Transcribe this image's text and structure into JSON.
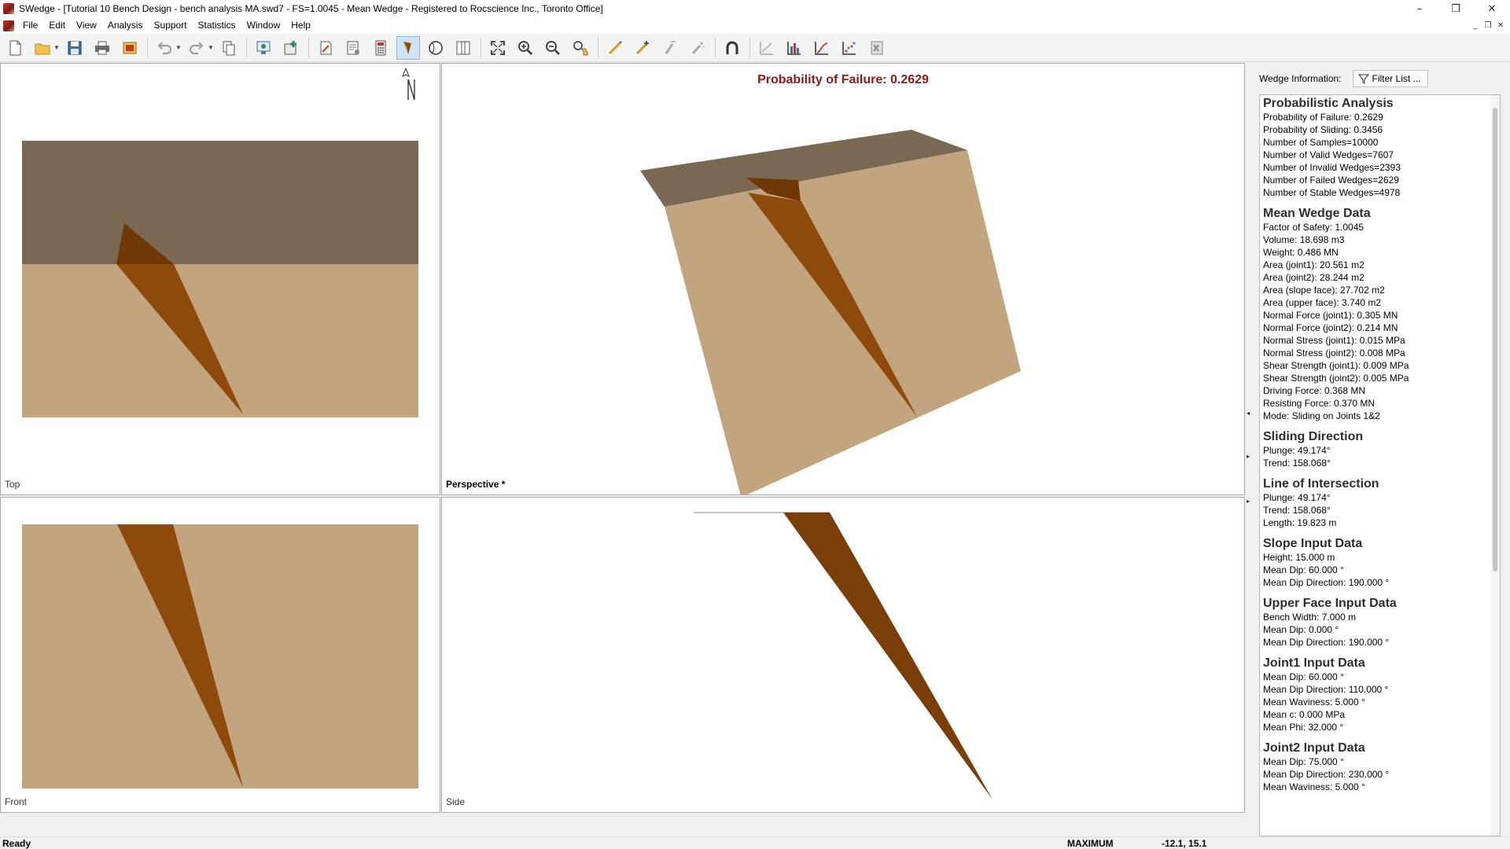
{
  "window": {
    "title": "SWedge - [Tutorial 10 Bench Design - bench analysis MA.swd7 - FS=1.0045 - Mean Wedge - Registered to Rocscience Inc., Toronto Office]",
    "controls": {
      "minimize": "–",
      "maximize": "❐",
      "close": "✕"
    }
  },
  "menu": {
    "items": [
      "File",
      "Edit",
      "View",
      "Analysis",
      "Support",
      "Statistics",
      "Window",
      "Help"
    ],
    "mdi": {
      "minimize": "_",
      "restore": "❐",
      "close": "✕"
    }
  },
  "toolbar": {
    "icons": [
      "new-file-icon",
      "open-folder-icon",
      "save-icon",
      "print-icon",
      "export-image-icon",
      "undo-icon",
      "redo-icon",
      "copy-icon",
      "input-data-icon",
      "add-joint-icon",
      "field-data-icon",
      "analysis-settings-icon",
      "compute-icon",
      "wedge-view-icon",
      "stereonet-icon",
      "split-view-icon",
      "zoom-all-icon",
      "zoom-in-icon",
      "zoom-out-icon",
      "pan-icon",
      "measure-icon",
      "add-pin-icon",
      "remove-pin-icon",
      "wand-icon",
      "magnet-icon",
      "line-chart-disabled-icon",
      "histogram-icon",
      "cumulative-icon",
      "scatter-icon",
      "excel-icon"
    ]
  },
  "views": {
    "top": {
      "label": "Top"
    },
    "perspective": {
      "label": "Perspective *",
      "heading": "Probability of Failure: 0.2629"
    },
    "front": {
      "label": "Front"
    },
    "side": {
      "label": "Side"
    }
  },
  "colors": {
    "upper_face": "#7b6852",
    "slope_face": "#c2a47f",
    "wedge": "#8e4a0a",
    "wedge_dark": "#6f3907",
    "side_wedge": "#7a3e08",
    "heading": "#8b1a1a"
  },
  "panel": {
    "header_label": "Wedge Information:",
    "filter_label": "Filter List ...",
    "sections": [
      {
        "title": "Probabilistic Analysis",
        "lines": [
          "Probability of Failure: 0.2629",
          "Probability of Sliding: 0.3456",
          "Number of Samples=10000",
          "Number of Valid Wedges=7607",
          "Number of Invalid Wedges=2393",
          "Number of Failed Wedges=2629",
          "Number of Stable Wedges=4978"
        ]
      },
      {
        "title": "Mean Wedge Data",
        "lines": [
          "Factor of Safety: 1.0045",
          "Volume: 18.698 m3",
          "Weight: 0.486 MN",
          "Area (joint1): 20.561 m2",
          "Area (joint2): 28.244 m2",
          "Area (slope face): 27.702 m2",
          "Area (upper face): 3.740 m2",
          "Normal Force (joint1): 0.305 MN",
          "Normal Force (joint2): 0.214 MN",
          "Normal Stress (joint1): 0.015 MPa",
          "Normal Stress (joint2): 0.008 MPa",
          "Shear Strength (joint1): 0.009 MPa",
          "Shear Strength (joint2): 0.005 MPa",
          "Driving Force: 0.368 MN",
          "Resisting Force: 0.370 MN",
          "Mode: Sliding on Joints 1&2"
        ]
      },
      {
        "title": "Sliding Direction",
        "lines": [
          "Plunge: 49.174°",
          "Trend: 158.068°"
        ]
      },
      {
        "title": "Line of Intersection",
        "lines": [
          "Plunge: 49.174°",
          "Trend: 158.068°",
          "Length: 19.823 m"
        ]
      },
      {
        "title": "Slope Input Data",
        "lines": [
          "Height: 15.000 m",
          "Mean Dip: 60.000 °",
          "Mean Dip Direction: 190.000 °"
        ]
      },
      {
        "title": "Upper Face Input Data",
        "lines": [
          "Bench Width: 7.000 m",
          "Mean Dip: 0.000 °",
          "Mean Dip Direction: 190.000 °"
        ]
      },
      {
        "title": "Joint1 Input Data",
        "lines": [
          "Mean Dip: 60.000 °",
          "Mean Dip Direction: 110.000 °",
          "Mean Waviness: 5.000 °",
          "Mean c: 0.000 MPa",
          "Mean Phi: 32.000 °"
        ]
      },
      {
        "title": "Joint2 Input Data",
        "lines": [
          "Mean Dip: 75.000 °",
          "Mean Dip Direction: 230.000 °",
          "Mean Waviness: 5.000 °"
        ]
      }
    ]
  },
  "status": {
    "left": "Ready",
    "mode": "MAXIMUM",
    "coords": "-12.1, 15.1"
  }
}
